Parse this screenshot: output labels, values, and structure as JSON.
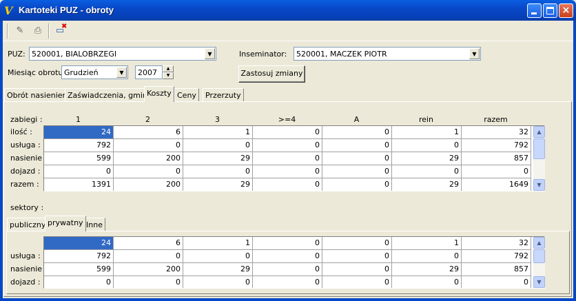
{
  "window": {
    "title": "Kartoteki PUZ - obroty"
  },
  "form": {
    "puz_label": "PUZ:",
    "puz_value": "520001, BIALOBRZEGI",
    "inseminator_label": "Inseminator:",
    "inseminator_value": "520001, MACZEK PIOTR",
    "miesiac_label": "Miesiąc obrotu :",
    "miesiac_value": "Grudzień",
    "year_value": "2007",
    "apply_label": "Zastosuj zmiany"
  },
  "tabs": [
    "Obrót nasieniem",
    "Zaświadczenia, gminy",
    "Koszty",
    "Ceny",
    "Przerzuty"
  ],
  "costs": {
    "zabiegi_label": "zabiegi :",
    "headers": [
      "1",
      "2",
      "3",
      ">=4",
      "A",
      "rein",
      "razem"
    ],
    "row_labels": [
      "ilość :",
      "usługa :",
      "nasienie :",
      "dojazd :",
      "razem :"
    ],
    "rows": [
      [
        "24",
        "6",
        "1",
        "0",
        "0",
        "1",
        "32"
      ],
      [
        "792",
        "0",
        "0",
        "0",
        "0",
        "0",
        "792"
      ],
      [
        "599",
        "200",
        "29",
        "0",
        "0",
        "29",
        "857"
      ],
      [
        "0",
        "0",
        "0",
        "0",
        "0",
        "0",
        "0"
      ],
      [
        "1391",
        "200",
        "29",
        "0",
        "0",
        "29",
        "1649"
      ]
    ]
  },
  "sectors": {
    "label": "sektory :",
    "tabs": [
      "publiczny",
      "prywatny",
      "Inne"
    ],
    "row_labels": [
      "",
      "usługa :",
      "nasienie :",
      "dojazd :"
    ],
    "rows": [
      [
        "24",
        "6",
        "1",
        "0",
        "0",
        "1",
        "32"
      ],
      [
        "792",
        "0",
        "0",
        "0",
        "0",
        "0",
        "792"
      ],
      [
        "599",
        "200",
        "29",
        "0",
        "0",
        "29",
        "857"
      ],
      [
        "0",
        "0",
        "0",
        "0",
        "0",
        "0",
        "0"
      ]
    ]
  }
}
